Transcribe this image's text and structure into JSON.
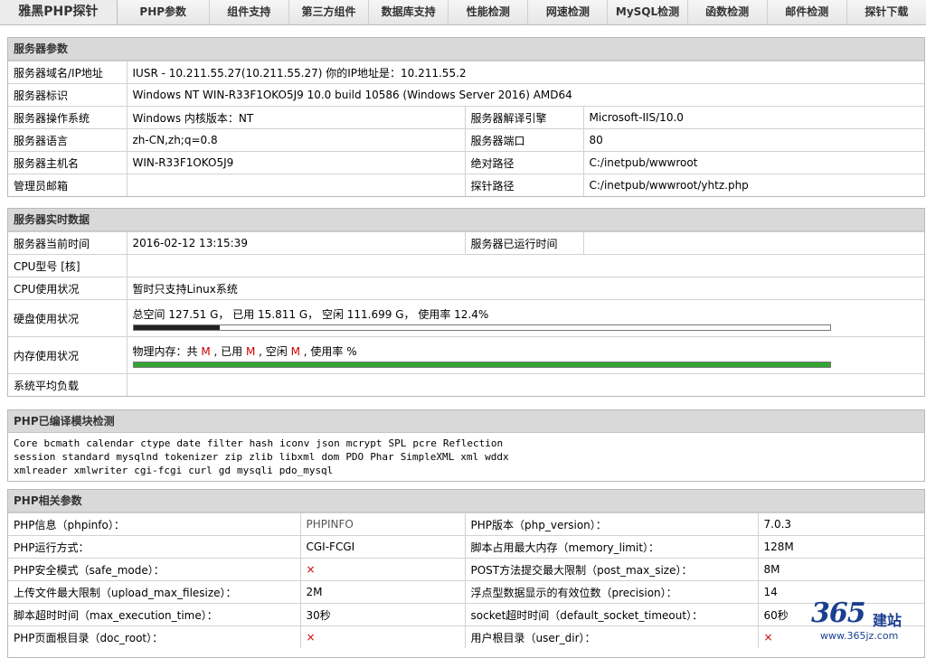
{
  "nav": {
    "brand": "雅黑PHP探针",
    "items": [
      "PHP参数",
      "组件支持",
      "第三方组件",
      "数据库支持",
      "性能检测",
      "网速检测",
      "MySQL检测",
      "函数检测",
      "邮件检测",
      "探针下载"
    ]
  },
  "server_params": {
    "title": "服务器参数",
    "domain_label": "服务器域名/IP地址",
    "domain_value": "IUSR - 10.211.55.27(10.211.55.27)  你的IP地址是：10.211.55.2",
    "id_label": "服务器标识",
    "id_value": "Windows NT WIN-R33F1OKO5J9 10.0 build 10586 (Windows Server 2016) AMD64",
    "os_label": "服务器操作系统",
    "os_value": "Windows  内核版本：NT",
    "engine_label": "服务器解译引擎",
    "engine_value": "Microsoft-IIS/10.0",
    "lang_label": "服务器语言",
    "lang_value": "zh-CN,zh;q=0.8",
    "port_label": "服务器端口",
    "port_value": "80",
    "host_label": "服务器主机名",
    "host_value": "WIN-R33F1OKO5J9",
    "abs_label": "绝对路径",
    "abs_value": "C:/inetpub/wwwroot",
    "admin_label": "管理员邮箱",
    "admin_value": "",
    "probe_label": "探针路径",
    "probe_value": "C:/inetpub/wwwroot/yhtz.php"
  },
  "realtime": {
    "title": "服务器实时数据",
    "time_label": "服务器当前时间",
    "time_value": "2016-02-12 13:15:39",
    "uptime_label": "服务器已运行时间",
    "uptime_value": "",
    "cpu_model_label": "CPU型号 [核]",
    "cpu_model_value": "",
    "cpu_usage_label": "CPU使用状况",
    "cpu_usage_value": "暂时只支持Linux系统",
    "disk_label": "硬盘使用状况",
    "disk_value": "总空间 127.51 G，  已用 15.811 G，  空闲 111.699 G，  使用率 12.4%",
    "disk_percent": 12.4,
    "disk_bar_color": "#222222",
    "mem_label": "内存使用状况",
    "mem_prefix": "物理内存：共 ",
    "mem_total": "M",
    "mem_used_prefix": " , 已用 ",
    "mem_used": "M",
    "mem_free_prefix": " , 空闲 ",
    "mem_free": "M",
    "mem_rate_prefix": " , 使用率 %",
    "mem_percent": 100,
    "mem_bar_color": "#33a532",
    "load_label": "系统平均负载",
    "load_value": ""
  },
  "modules": {
    "title": "PHP已编译模块检测",
    "list": [
      "Core",
      "bcmath",
      "calendar",
      "ctype",
      "date",
      "filter",
      "hash",
      "iconv",
      "json",
      "mcrypt",
      "SPL",
      "pcre",
      "Reflection",
      "session",
      "standard",
      "mysqlnd",
      "tokenizer",
      "zip",
      "zlib",
      "libxml",
      "dom",
      "PDO",
      "Phar",
      "SimpleXML",
      "xml",
      "wddx",
      "xmlreader",
      "xmlwriter",
      "cgi-fcgi",
      "curl",
      "gd",
      "mysqli",
      "pdo_mysql"
    ]
  },
  "php_params": {
    "title": "PHP相关参数",
    "rows": [
      {
        "l1": "PHP信息（phpinfo）：",
        "v1": "PHPINFO",
        "l2": "PHP版本（php_version）：",
        "v2": "7.0.3"
      },
      {
        "l1": "PHP运行方式：",
        "v1": "CGI-FCGI",
        "l2": "脚本占用最大内存（memory_limit）：",
        "v2": "128M"
      },
      {
        "l1": "PHP安全模式（safe_mode）：",
        "v1": "×",
        "l2": "POST方法提交最大限制（post_max_size）：",
        "v2": "8M"
      },
      {
        "l1": "上传文件最大限制（upload_max_filesize）：",
        "v1": "2M",
        "l2": "浮点型数据显示的有效位数（precision）：",
        "v2": "14"
      },
      {
        "l1": "脚本超时时间（max_execution_time）：",
        "v1": "30秒",
        "l2": "socket超时时间（default_socket_timeout）：",
        "v2": "60秒"
      },
      {
        "l1": "PHP页面根目录（doc_root）：",
        "v1": "×",
        "l2": "用户根目录（user_dir）：",
        "v2": "×"
      }
    ]
  },
  "watermark": {
    "num": "365",
    "cn": "建站",
    "url": "www.365jz.com"
  }
}
